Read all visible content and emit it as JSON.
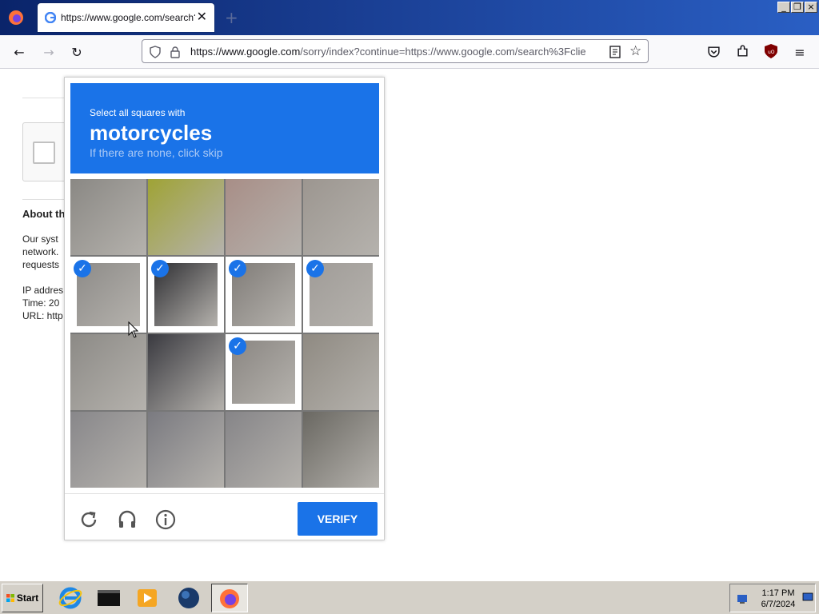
{
  "browser": {
    "tab_title": "https://www.google.com/search?c",
    "url_domain": "https://www.google.com",
    "url_rest": "/sorry/index?continue=https://www.google.com/search%3Fclie",
    "close_glyph": "✕",
    "newtab_glyph": "+"
  },
  "background": {
    "heading": "About th",
    "body_lines": [
      "Our syst",
      "network.",
      "requests"
    ],
    "ip_label": "IP addres",
    "time_label": "Time: 20",
    "url_label": "URL: http"
  },
  "captcha": {
    "instruction": "Select all squares with",
    "target": "motorcycles",
    "hint": "If there are none, click skip",
    "verify_label": "VERIFY",
    "tiles": [
      {
        "row": 0,
        "col": 0,
        "selected": false,
        "color": "#8a8884"
      },
      {
        "row": 0,
        "col": 1,
        "selected": false,
        "color": "#9fa335"
      },
      {
        "row": 0,
        "col": 2,
        "selected": false,
        "color": "#a88e87"
      },
      {
        "row": 0,
        "col": 3,
        "selected": false,
        "color": "#9c9690"
      },
      {
        "row": 1,
        "col": 0,
        "selected": true,
        "color": "#8d8b88"
      },
      {
        "row": 1,
        "col": 1,
        "selected": true,
        "color": "#2f2f33"
      },
      {
        "row": 1,
        "col": 2,
        "selected": true,
        "color": "#807c78"
      },
      {
        "row": 1,
        "col": 3,
        "selected": true,
        "color": "#a09c98"
      },
      {
        "row": 2,
        "col": 0,
        "selected": false,
        "color": "#8c8a86"
      },
      {
        "row": 2,
        "col": 1,
        "selected": false,
        "color": "#3a3a40"
      },
      {
        "row": 2,
        "col": 2,
        "selected": true,
        "color": "#8a8682"
      },
      {
        "row": 2,
        "col": 3,
        "selected": false,
        "color": "#8f8a82"
      },
      {
        "row": 3,
        "col": 0,
        "selected": false,
        "color": "#88878a"
      },
      {
        "row": 3,
        "col": 1,
        "selected": false,
        "color": "#7a7a80"
      },
      {
        "row": 3,
        "col": 2,
        "selected": false,
        "color": "#868588"
      },
      {
        "row": 3,
        "col": 3,
        "selected": false,
        "color": "#6a6862"
      }
    ]
  },
  "taskbar": {
    "start_label": "Start",
    "time": "1:17 PM",
    "date": "6/7/2024"
  },
  "colors": {
    "accent": "#1a73e8",
    "titlebar": "#0a246a"
  }
}
